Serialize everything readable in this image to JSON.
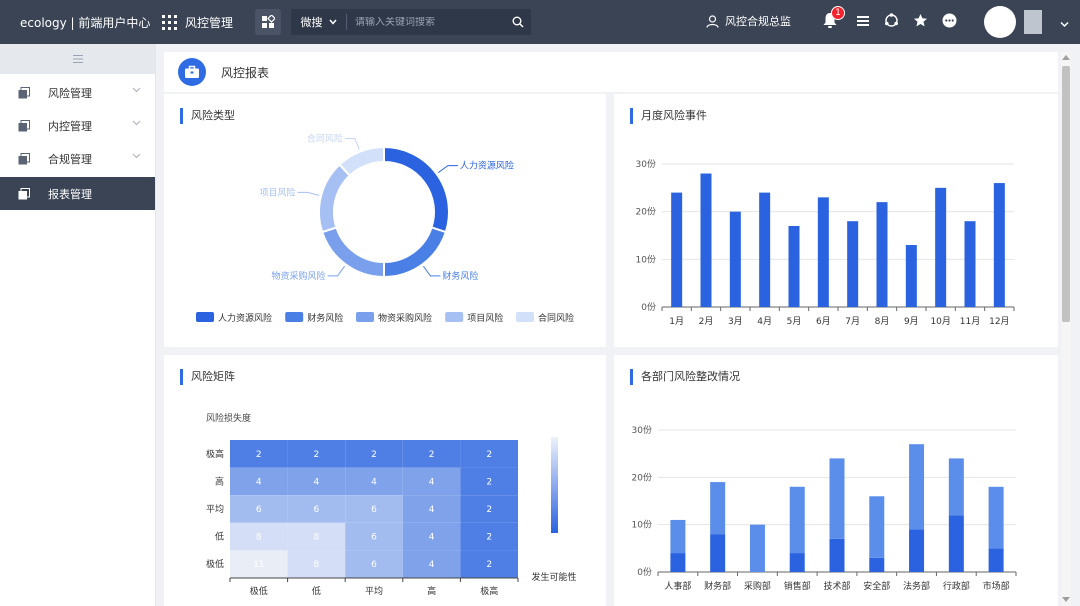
{
  "topbar": {
    "brand": "ecology | 前端用户中心",
    "app_title": "风控管理",
    "search_type": "微搜",
    "search_placeholder": "请输入关键词搜索",
    "supervisor_label": "风控合规总监",
    "notification_count": "1",
    "icons": [
      "apps-grid-icon",
      "modules-icon",
      "search-icon",
      "user-icon",
      "bell-icon",
      "list-icon",
      "sync-icon",
      "star-icon",
      "more-icon",
      "chevron-down-icon"
    ]
  },
  "sidebar": {
    "items": [
      {
        "label": "风险管理",
        "active": false,
        "has_children": true
      },
      {
        "label": "内控管理",
        "active": false,
        "has_children": true
      },
      {
        "label": "合规管理",
        "active": false,
        "has_children": true
      },
      {
        "label": "报表管理",
        "active": true,
        "has_children": false
      }
    ]
  },
  "page": {
    "title": "风控报表"
  },
  "panels": {
    "risk_type": {
      "title": "风险类型"
    },
    "monthly": {
      "title": "月度风险事件"
    },
    "matrix": {
      "title": "风险矩阵"
    },
    "dept": {
      "title": "各部门风险整改情况"
    }
  },
  "colors": {
    "topbar": "#3a4455",
    "accent": "#2f6be3",
    "bar": "#2a62e0",
    "bar_light": "#5b8eea",
    "slices": [
      "#2a62e0",
      "#4a7fe6",
      "#7aa0ed",
      "#a6c0f3",
      "#d3e0f9"
    ]
  },
  "chart_data": [
    {
      "type": "pie",
      "title": "风险类型",
      "labels": [
        "人力资源风险",
        "财务风险",
        "物资采购风险",
        "项目风险",
        "合同风险"
      ],
      "values": [
        30,
        20,
        20,
        18,
        12
      ],
      "legend": "bottom"
    },
    {
      "type": "bar",
      "title": "月度风险事件",
      "categories": [
        "1月",
        "2月",
        "3月",
        "4月",
        "5月",
        "6月",
        "7月",
        "8月",
        "9月",
        "10月",
        "11月",
        "12月"
      ],
      "values": [
        24,
        28,
        20,
        24,
        17,
        23,
        18,
        22,
        13,
        25,
        18,
        26
      ],
      "ylim": [
        0,
        30
      ],
      "yticks": [
        "0份",
        "10份",
        "20份",
        "30份"
      ],
      "grid": true
    },
    {
      "type": "heatmap",
      "title": "风险矩阵",
      "ylabel": "风险损失度",
      "xlabel": "发生可能性",
      "x_categories": [
        "极低",
        "低",
        "平均",
        "高",
        "极高"
      ],
      "y_categories": [
        "极高",
        "高",
        "平均",
        "低",
        "极低"
      ],
      "values": [
        [
          2,
          2,
          2,
          2,
          2
        ],
        [
          4,
          4,
          4,
          4,
          2
        ],
        [
          6,
          6,
          6,
          4,
          2
        ],
        [
          8,
          8,
          6,
          4,
          2
        ],
        [
          11,
          8,
          6,
          4,
          2
        ]
      ],
      "levels": [
        [
          5,
          5,
          5,
          5,
          5
        ],
        [
          4,
          4,
          4,
          4,
          5
        ],
        [
          3,
          3,
          3,
          4,
          5
        ],
        [
          1,
          1,
          3,
          4,
          5
        ],
        [
          0,
          1,
          3,
          4,
          5
        ]
      ],
      "level_colors": [
        "#e9edf5",
        "#d4def6",
        "#b8caf3",
        "#a3bcf0",
        "#7fa2eb",
        "#4f7fe5"
      ],
      "text_colors": [
        "#ffffff",
        "#ffffff",
        "#ffffff",
        "#ffffff",
        "#ffffff",
        "#ffffff"
      ],
      "visual_map": "vertical-gradient"
    },
    {
      "type": "bar",
      "title": "各部门风险整改情况",
      "stacked": true,
      "categories": [
        "人事部",
        "财务部",
        "采购部",
        "销售部",
        "技术部",
        "安全部",
        "法务部",
        "行政部",
        "市场部"
      ],
      "series": [
        {
          "values": [
            4,
            8,
            0,
            4,
            7,
            3,
            9,
            12,
            5
          ]
        },
        {
          "values": [
            7,
            11,
            10,
            14,
            17,
            13,
            18,
            12,
            13
          ]
        }
      ],
      "ylim": [
        0,
        30
      ],
      "yticks": [
        "0份",
        "10份",
        "20份",
        "30份"
      ],
      "grid": true
    }
  ]
}
